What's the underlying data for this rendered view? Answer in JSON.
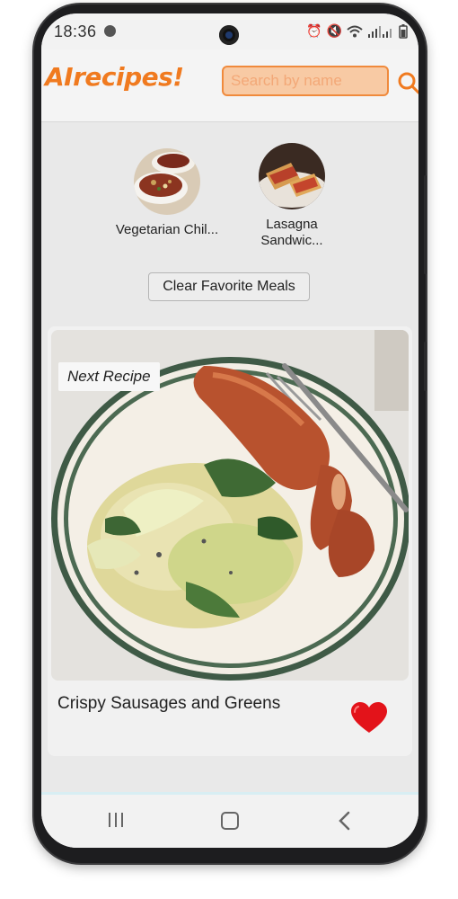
{
  "status_bar": {
    "time": "18:36",
    "icons": [
      "dnd-icon",
      "alarm-icon",
      "mute-icon",
      "wifi-icon",
      "signal-icon",
      "battery-icon"
    ]
  },
  "header": {
    "logo": "AIrecipes!",
    "search_placeholder": "Search by name",
    "search_value": "",
    "accent_color": "#f07a1f"
  },
  "favorites": [
    {
      "name": "Vegetarian Chil..."
    },
    {
      "name": "Lasagna Sandwic..."
    }
  ],
  "clear_button": {
    "label": "Clear Favorite Meals"
  },
  "recipe_card": {
    "badge": "Next Recipe",
    "title": "Crispy Sausages and Greens",
    "favorited": true
  },
  "nav_bar": {
    "icons": [
      "recent-apps-icon",
      "home-icon",
      "back-icon"
    ]
  }
}
